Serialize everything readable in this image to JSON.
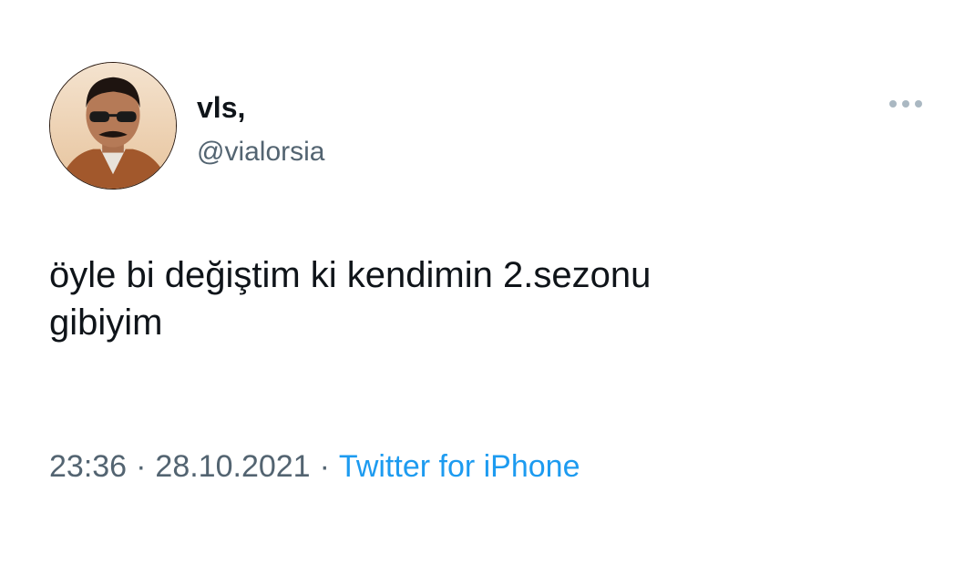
{
  "tweet": {
    "author": {
      "display_name": "vls,",
      "handle": "@vialorsia",
      "avatar_icon": "profile-photo"
    },
    "more_icon": "ellipsis-icon",
    "text": "öyle bi değiştim ki kendimin 2.sezonu\ngibiyim",
    "time": "23:36",
    "separator": "·",
    "date": "28.10.2021",
    "source": "Twitter for iPhone"
  },
  "colors": {
    "primary_text": "#0f1419",
    "secondary_text": "#536471",
    "link": "#1d9bf0",
    "background": "#ffffff"
  }
}
